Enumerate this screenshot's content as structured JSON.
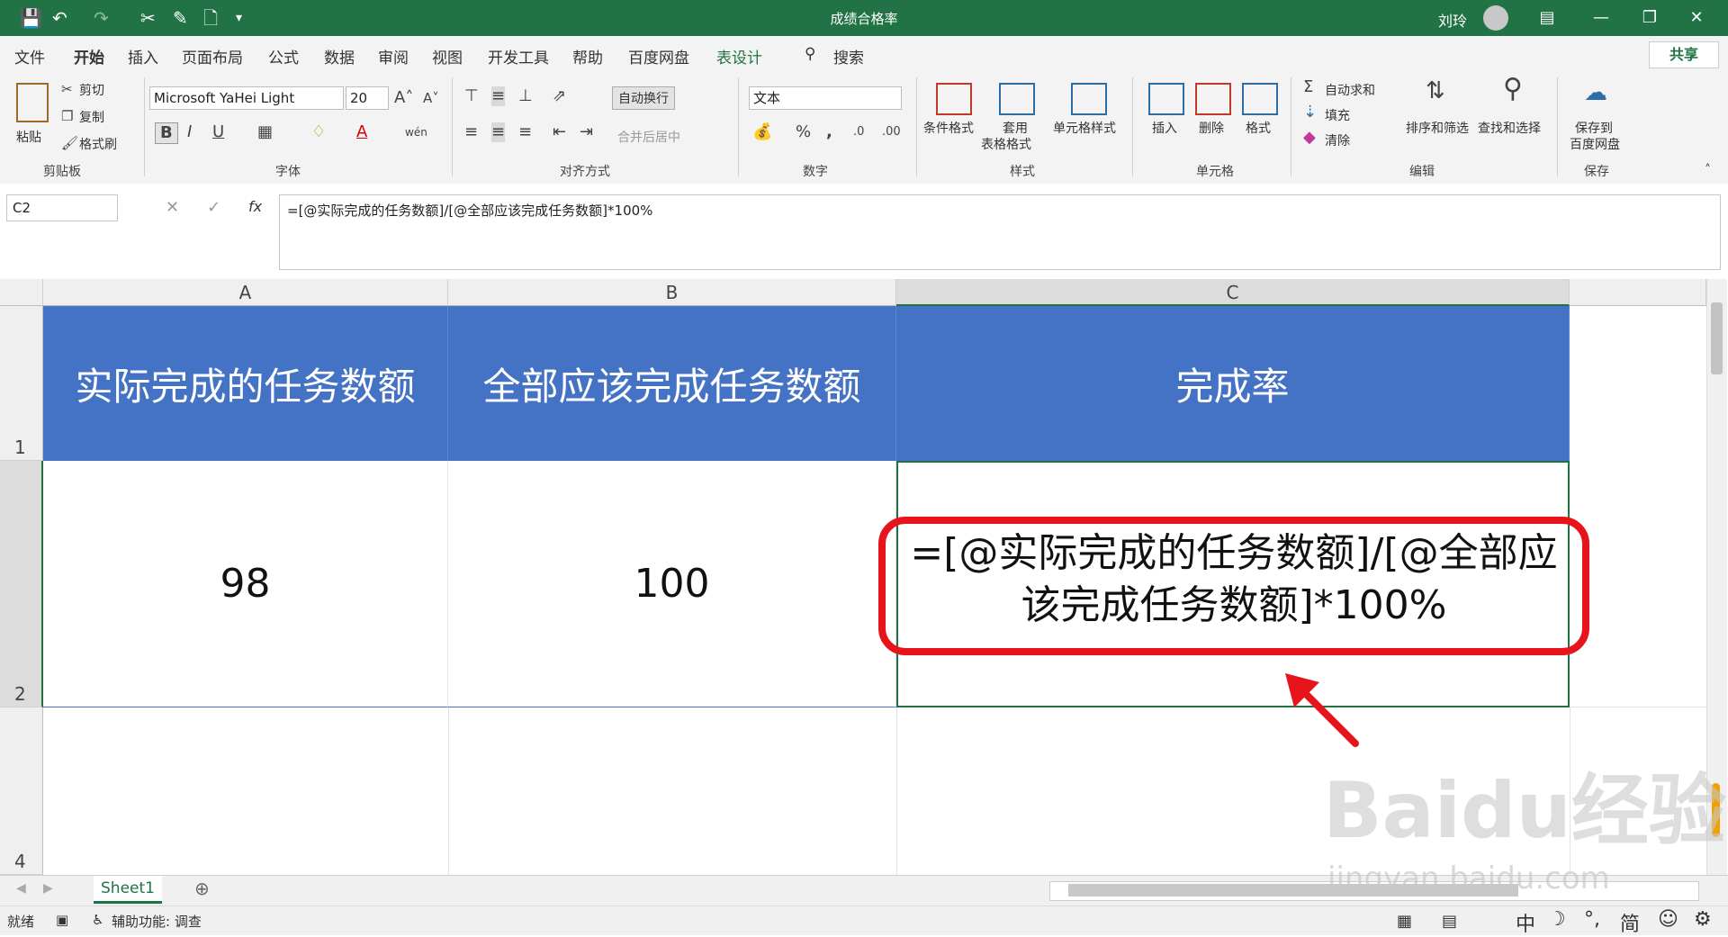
{
  "window": {
    "title": "成绩合格率",
    "user": "刘玲"
  },
  "menu": {
    "items": [
      "文件",
      "开始",
      "插入",
      "页面布局",
      "公式",
      "数据",
      "审阅",
      "视图",
      "开发工具",
      "帮助",
      "百度网盘",
      "表设计"
    ],
    "search": "搜索",
    "share": "共享"
  },
  "ribbon": {
    "clipboard": {
      "label": "剪贴板",
      "paste": "粘贴",
      "cut": "剪切",
      "copy": "复制",
      "painter": "格式刷"
    },
    "font": {
      "label": "字体",
      "name": "Microsoft YaHei Light",
      "size": "20"
    },
    "alignment": {
      "label": "对齐方式",
      "wrap": "自动换行",
      "merge": "合并后居中"
    },
    "number": {
      "label": "数字",
      "format": "文本"
    },
    "styles": {
      "label": "样式",
      "conditional": "条件格式",
      "table_line1": "套用",
      "table_line2": "表格格式",
      "cell_styles": "单元格样式"
    },
    "cells": {
      "label": "单元格",
      "insert": "插入",
      "delete": "删除",
      "format": "格式"
    },
    "editing": {
      "label": "编辑",
      "autosum": "自动求和",
      "fill": "填充",
      "clear": "清除",
      "sort": "排序和筛选",
      "find": "查找和选择"
    },
    "save": {
      "label": "保存",
      "line1": "保存到",
      "line2": "百度网盘"
    }
  },
  "formula_bar": {
    "name_box": "C2",
    "fx": "fx",
    "formula": "=[@实际完成的任务数额]/[@全部应该完成任务数额]*100%"
  },
  "sheet": {
    "columns": [
      "A",
      "B",
      "C"
    ],
    "rows": [
      "1",
      "2",
      "4"
    ],
    "headers": [
      "实际完成的任务数额",
      "全部应该完成任务数额",
      "完成率"
    ],
    "row2": [
      "98",
      "100"
    ],
    "c2_formula_line1": "=[@实际完成的任务数额]/[@全部应",
    "c2_formula_line2": "该完成任务数额]*100%"
  },
  "tabs": {
    "sheet1": "Sheet1"
  },
  "status": {
    "ready": "就绪",
    "accessibility": "辅助功能: 调查",
    "ime": [
      "中",
      "简"
    ]
  },
  "watermark": {
    "text": "Baidu经验",
    "url": "jingyan.baidu.com"
  },
  "colors": {
    "excel_green": "#217346",
    "header_blue": "#4472c4",
    "highlight_red": "#e8141c"
  }
}
